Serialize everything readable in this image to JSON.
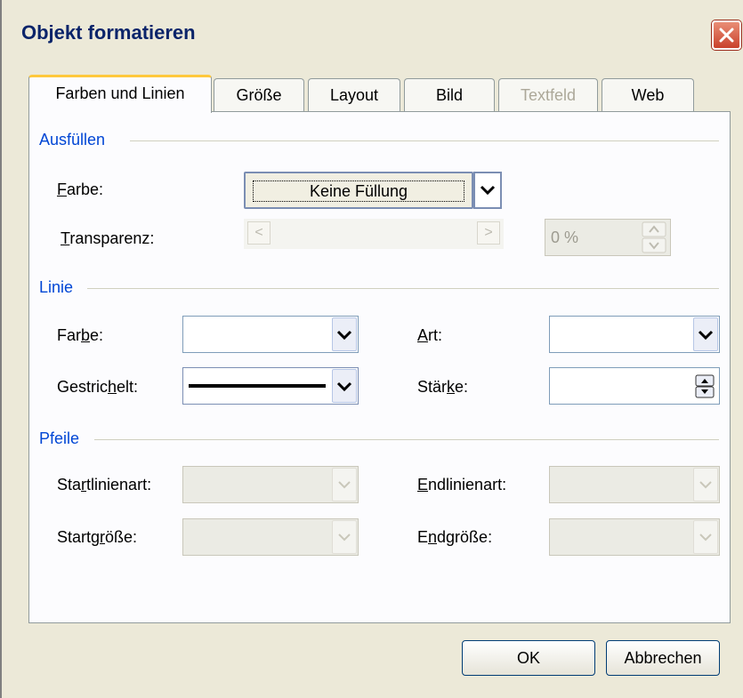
{
  "window": {
    "title": "Objekt formatieren"
  },
  "tabs": [
    {
      "label": "Farben und Linien",
      "state": "active"
    },
    {
      "label": "Größe",
      "state": "normal"
    },
    {
      "label": "Layout",
      "state": "normal"
    },
    {
      "label": "Bild",
      "state": "normal"
    },
    {
      "label": "Textfeld",
      "state": "disabled"
    },
    {
      "label": "Web",
      "state": "normal"
    }
  ],
  "fill": {
    "section": "Ausfüllen",
    "color_label": {
      "pre": "",
      "u": "F",
      "post": "arbe:"
    },
    "color_value": "Keine Füllung",
    "transparency_label": {
      "pre": "",
      "u": "T",
      "post": "ransparenz:"
    },
    "transparency_value": "0 %"
  },
  "line": {
    "section": "Linie",
    "color_label": {
      "pre": "Far",
      "u": "b",
      "post": "e:"
    },
    "color_value": "",
    "dashed_label": {
      "pre": "Gestric",
      "u": "h",
      "post": "elt:"
    },
    "style_label": {
      "pre": "",
      "u": "A",
      "post": "rt:"
    },
    "style_value": "",
    "weight_label": {
      "pre": "Stär",
      "u": "k",
      "post": "e:"
    },
    "weight_value": ""
  },
  "arrows": {
    "section": "Pfeile",
    "start_style_label": {
      "pre": "Sta",
      "u": "r",
      "post": "tlinienart:"
    },
    "start_size_label": {
      "pre": "Startg",
      "u": "r",
      "post": "öße:"
    },
    "end_style_label": {
      "pre": "",
      "u": "E",
      "post": "ndlinienart:"
    },
    "end_size_label": {
      "pre": "E",
      "u": "n",
      "post": "dgröße:"
    }
  },
  "buttons": {
    "ok": "OK",
    "cancel": "Abbrechen"
  },
  "colors": {
    "section_text": "#0046d5",
    "title_text": "#0a246a",
    "dialog_bg": "#ece9d8",
    "active_tab_accent": "#ffc83c",
    "close_button": "#c9412c"
  },
  "icons": {
    "close": "close-icon",
    "dropdown": "chevron-down-icon",
    "scroll_left": "arrow-left-icon",
    "scroll_right": "arrow-right-icon",
    "spin": "spin-updown-icon"
  }
}
